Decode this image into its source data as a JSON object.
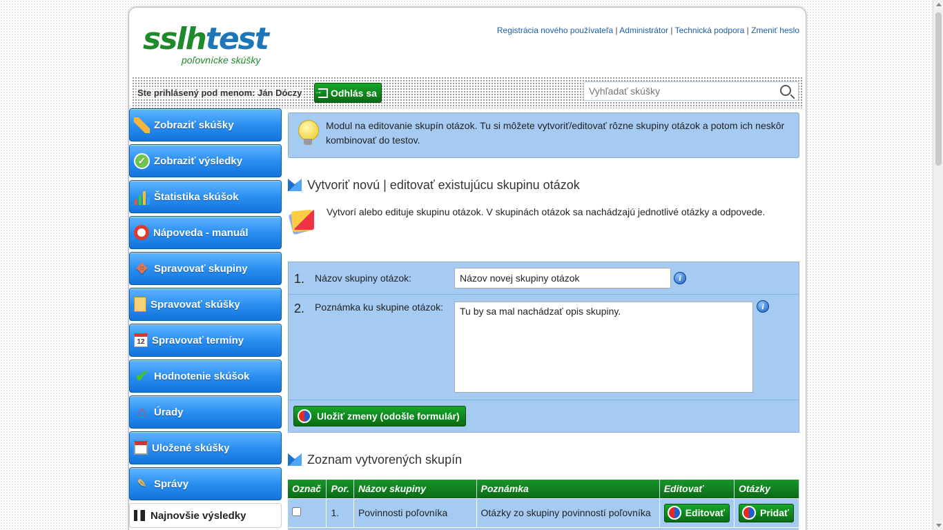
{
  "header": {
    "logo_main_a": "sslh",
    "logo_main_b": "test",
    "logo_sub": "poľovnícke skúšky",
    "links": [
      "Registrácia nového používateľa",
      "Administrátor",
      "Technická podpora",
      "Zmeniť heslo"
    ],
    "separator": "|",
    "login_text": "Ste prihlásený pod menom: Ján Dóczy",
    "logout_label": "Odhlás sa",
    "search_placeholder": "Vyhľadať skúšky"
  },
  "sidebar": {
    "items": [
      {
        "label": "Zobraziť skúšky",
        "icon": "pencil-icon"
      },
      {
        "label": "Zobraziť výsledky",
        "icon": "check-circle-icon"
      },
      {
        "label": "Štatistika skúšok",
        "icon": "bar-chart-icon"
      },
      {
        "label": "Nápoveda - manuál",
        "icon": "lifebuoy-icon"
      },
      {
        "label": "Spravovať skupiny",
        "icon": "groups-icon"
      },
      {
        "label": "Spravovať skúšky",
        "icon": "exam-sheet-icon"
      },
      {
        "label": "Spravovať termíny",
        "icon": "calendar-icon"
      },
      {
        "label": "Hodnotenie skúšok",
        "icon": "checkmark-icon"
      },
      {
        "label": "Úrady",
        "icon": "home-icon"
      },
      {
        "label": "Uložené skúšky",
        "icon": "floppy-disk-icon"
      },
      {
        "label": "Správy",
        "icon": "messages-icon"
      }
    ],
    "latest_label": "Najnovšie výsledky",
    "calendar_day": "12"
  },
  "main": {
    "info_text": "Modul na editovanie skupín otázok. Tu si môžete vytvoriť/editovať rôzne skupiny otázok a potom ich neskôr kombinovať do testov.",
    "section1_title": "Vytvoriť novú | editovať existujúcu skupinu otázok",
    "section1_desc": "Vytvorí alebo edituje skupinu otázok. V skupinách otázok sa nachádzajú jednotlivé otázky a odpovede.",
    "form": {
      "row1_num": "1.",
      "row1_label": "Názov skupiny otázok:",
      "row1_value": "Názov novej skupiny otázok",
      "row2_num": "2.",
      "row2_label": "Poznámka ku skupine otázok:",
      "row2_value": "Tu by sa mal nachádzať opis skupiny.",
      "info_glyph": "i",
      "save_label": "Uložiť zmeny (odošle formulár)"
    },
    "section2_title": "Zoznam vytvorených skupín",
    "table": {
      "headers": [
        "Označ",
        "Por.",
        "Názov skupiny",
        "Poznámka",
        "Editovať",
        "Otázky"
      ],
      "rows": [
        {
          "num": "1.",
          "name": "Povinnosti poľovníka",
          "note": "Otázky zo skupiny povinností poľovníka",
          "edit_label": "Editovať",
          "questions_label": "Pridať"
        }
      ]
    }
  },
  "colors": {
    "nav_blue": "#2b8ff1",
    "button_green": "#0a6b13",
    "panel_blue": "#a6cbf3",
    "logo_green": "#1e8a2c",
    "logo_blue": "#1d76b8"
  }
}
